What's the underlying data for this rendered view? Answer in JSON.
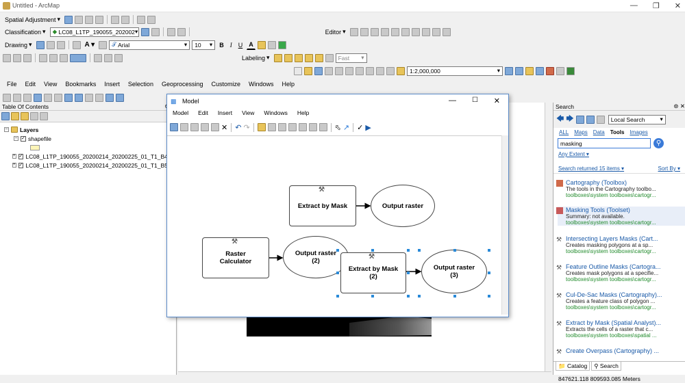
{
  "window": {
    "title": "Untitled - ArcMap"
  },
  "toolbars": {
    "spatial_adjustment": "Spatial Adjustment",
    "classification": "Classification",
    "layer_select": "LC08_L1TP_190055_202002",
    "drawing": "Drawing",
    "font_name": "Arial",
    "font_size": "10",
    "bold": "B",
    "italic": "I",
    "underline": "U",
    "font_color": "A",
    "editor": "Editor",
    "labeling": "Labeling",
    "label_speed": "Fast",
    "scale": "1:2,000,000"
  },
  "menu": [
    "File",
    "Edit",
    "View",
    "Bookmarks",
    "Insert",
    "Selection",
    "Geoprocessing",
    "Customize",
    "Windows",
    "Help"
  ],
  "toc": {
    "title": "Table Of Contents",
    "layers_label": "Layers",
    "items": [
      {
        "name": "shapefile"
      },
      {
        "name": "LC08_L1TP_190055_20200214_20200225_01_T1_B4.T"
      },
      {
        "name": "LC08_L1TP_190055_20200214_20200225_01_T1_B5.T"
      }
    ]
  },
  "model": {
    "title": "Model",
    "menu": [
      "Model",
      "Edit",
      "Insert",
      "View",
      "Windows",
      "Help"
    ],
    "nodes": {
      "extract1": "Extract by Mask",
      "out1": "Output raster",
      "calc": "Raster\nCalculator",
      "out2": "Output raster\n(2)",
      "extract2": "Extract by Mask\n(2)",
      "out3": "Output raster\n(3)"
    }
  },
  "search": {
    "title": "Search",
    "scope": "Local Search",
    "tabs": [
      "ALL",
      "Maps",
      "Data",
      "Tools",
      "Images"
    ],
    "active_tab": "Tools",
    "query": "masking",
    "extent": "Any Extent",
    "returned": "Search returned 15 items",
    "sort": "Sort By",
    "results": [
      {
        "title": "Cartography (Toolbox)",
        "summary": "The tools in the Cartography toolbo...",
        "path": "toolboxes\\system toolboxes\\cartogr..."
      },
      {
        "title": "Masking Tools (Toolset)",
        "summary": "Summary: not available.",
        "path": "toolboxes\\system toolboxes\\cartogr..."
      },
      {
        "title": "Intersecting Layers Masks (Cart...",
        "summary": "Creates masking polygons at a sp...",
        "path": "toolboxes\\system toolboxes\\cartogr..."
      },
      {
        "title": "Feature Outline Masks (Cartogra...",
        "summary": "Creates mask polygons at a specifie...",
        "path": "toolboxes\\system toolboxes\\cartogr..."
      },
      {
        "title": "Cul-De-Sac Masks (Cartography)...",
        "summary": "Creates a feature class of polygon ...",
        "path": "toolboxes\\system toolboxes\\cartogr..."
      },
      {
        "title": "Extract by Mask (Spatial Analyst)...",
        "summary": "Extracts the cells of a raster that c...",
        "path": "toolboxes\\system toolboxes\\spatial ..."
      },
      {
        "title": "Create Overpass (Cartography) ...",
        "summary": "",
        "path": ""
      }
    ],
    "bottom_tabs": [
      "Catalog",
      "Search"
    ]
  },
  "status": {
    "coords": "847621.118  809593.085 Meters"
  }
}
